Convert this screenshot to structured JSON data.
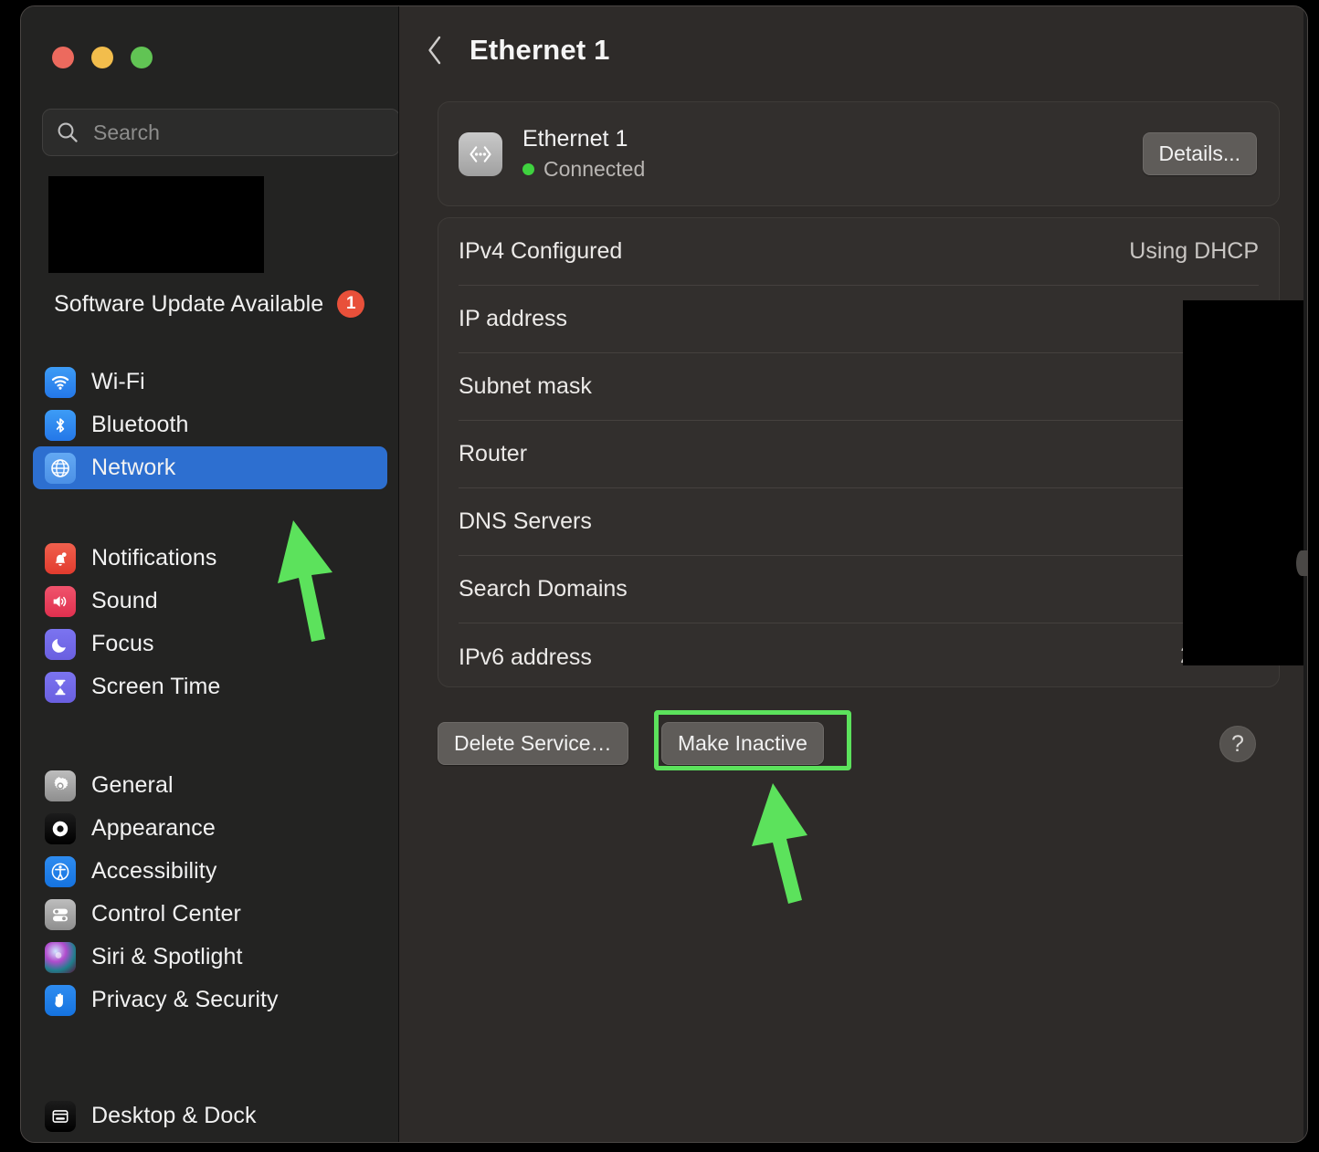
{
  "window": {
    "traffic_lights": [
      {
        "name": "close",
        "color": "#ec6a5e"
      },
      {
        "name": "minimize",
        "color": "#f2bd4c"
      },
      {
        "name": "zoom",
        "color": "#61c454"
      }
    ]
  },
  "sidebar": {
    "search": {
      "placeholder": "Search",
      "value": "",
      "icon": "search-icon"
    },
    "account": {
      "redacted": true
    },
    "update_banner": {
      "label": "Software Update Available",
      "badge_count": "1",
      "badge_color": "#e8503a"
    },
    "groups": [
      {
        "items": [
          {
            "label": "Wi-Fi",
            "icon": "wifi-icon",
            "icon_class": "ic-wifi",
            "selected": false
          },
          {
            "label": "Bluetooth",
            "icon": "bluetooth-icon",
            "icon_class": "ic-bluetooth",
            "selected": false
          },
          {
            "label": "Network",
            "icon": "globe-icon",
            "icon_class": "ic-network",
            "selected": true
          }
        ]
      },
      {
        "items": [
          {
            "label": "Notifications",
            "icon": "bell-icon",
            "icon_class": "ic-notif",
            "selected": false
          },
          {
            "label": "Sound",
            "icon": "speaker-icon",
            "icon_class": "ic-sound",
            "selected": false
          },
          {
            "label": "Focus",
            "icon": "moon-icon",
            "icon_class": "ic-focus",
            "selected": false
          },
          {
            "label": "Screen Time",
            "icon": "hourglass-icon",
            "icon_class": "ic-screen",
            "selected": false
          }
        ]
      },
      {
        "items": [
          {
            "label": "General",
            "icon": "gear-icon",
            "icon_class": "ic-general",
            "selected": false
          },
          {
            "label": "Appearance",
            "icon": "contrast-circle-icon",
            "icon_class": "ic-appear",
            "selected": false
          },
          {
            "label": "Accessibility",
            "icon": "accessibility-person-icon",
            "icon_class": "ic-access",
            "selected": false
          },
          {
            "label": "Control Center",
            "icon": "sliders-icon",
            "icon_class": "ic-control",
            "selected": false
          },
          {
            "label": "Siri & Spotlight",
            "icon": "siri-orb-icon",
            "icon_class": "ic-siri",
            "selected": false
          },
          {
            "label": "Privacy & Security",
            "icon": "hand-icon",
            "icon_class": "ic-privacy",
            "selected": false
          }
        ]
      },
      {
        "items": [
          {
            "label": "Desktop & Dock",
            "icon": "desktop-window-icon",
            "icon_class": "ic-desktop",
            "selected": false
          }
        ]
      }
    ],
    "selected_item": "Network"
  },
  "main": {
    "header": {
      "back_icon": "chevron-left-icon",
      "title": "Ethernet 1"
    },
    "service_card": {
      "icon": "ethernet-icon",
      "name": "Ethernet 1",
      "status": "Connected",
      "status_color": "#3fd23f",
      "details_button": "Details..."
    },
    "info_rows": [
      {
        "label": "IPv4 Configured",
        "value": "Using DHCP",
        "redacted": false
      },
      {
        "label": "IP address",
        "value": "",
        "redacted": true
      },
      {
        "label": "Subnet mask",
        "value": "",
        "redacted": true
      },
      {
        "label": "Router",
        "value": "",
        "redacted": true
      },
      {
        "label": "DNS Servers",
        "value": "",
        "redacted": true
      },
      {
        "label": "Search Domains",
        "value": "",
        "redacted": true
      },
      {
        "label": "IPv6 address",
        "value": "2",
        "redacted": true
      }
    ],
    "buttons": {
      "delete_service": "Delete Service…",
      "make_inactive": "Make Inactive",
      "help": "?"
    }
  },
  "annotations": {
    "highlight_color": "#5ce25c",
    "arrows": [
      {
        "name": "arrow-to-network-sidebar-item",
        "points_to": "Network"
      },
      {
        "name": "arrow-to-make-inactive-button",
        "points_to": "Make Inactive"
      }
    ],
    "highlight_target": "Make Inactive"
  }
}
